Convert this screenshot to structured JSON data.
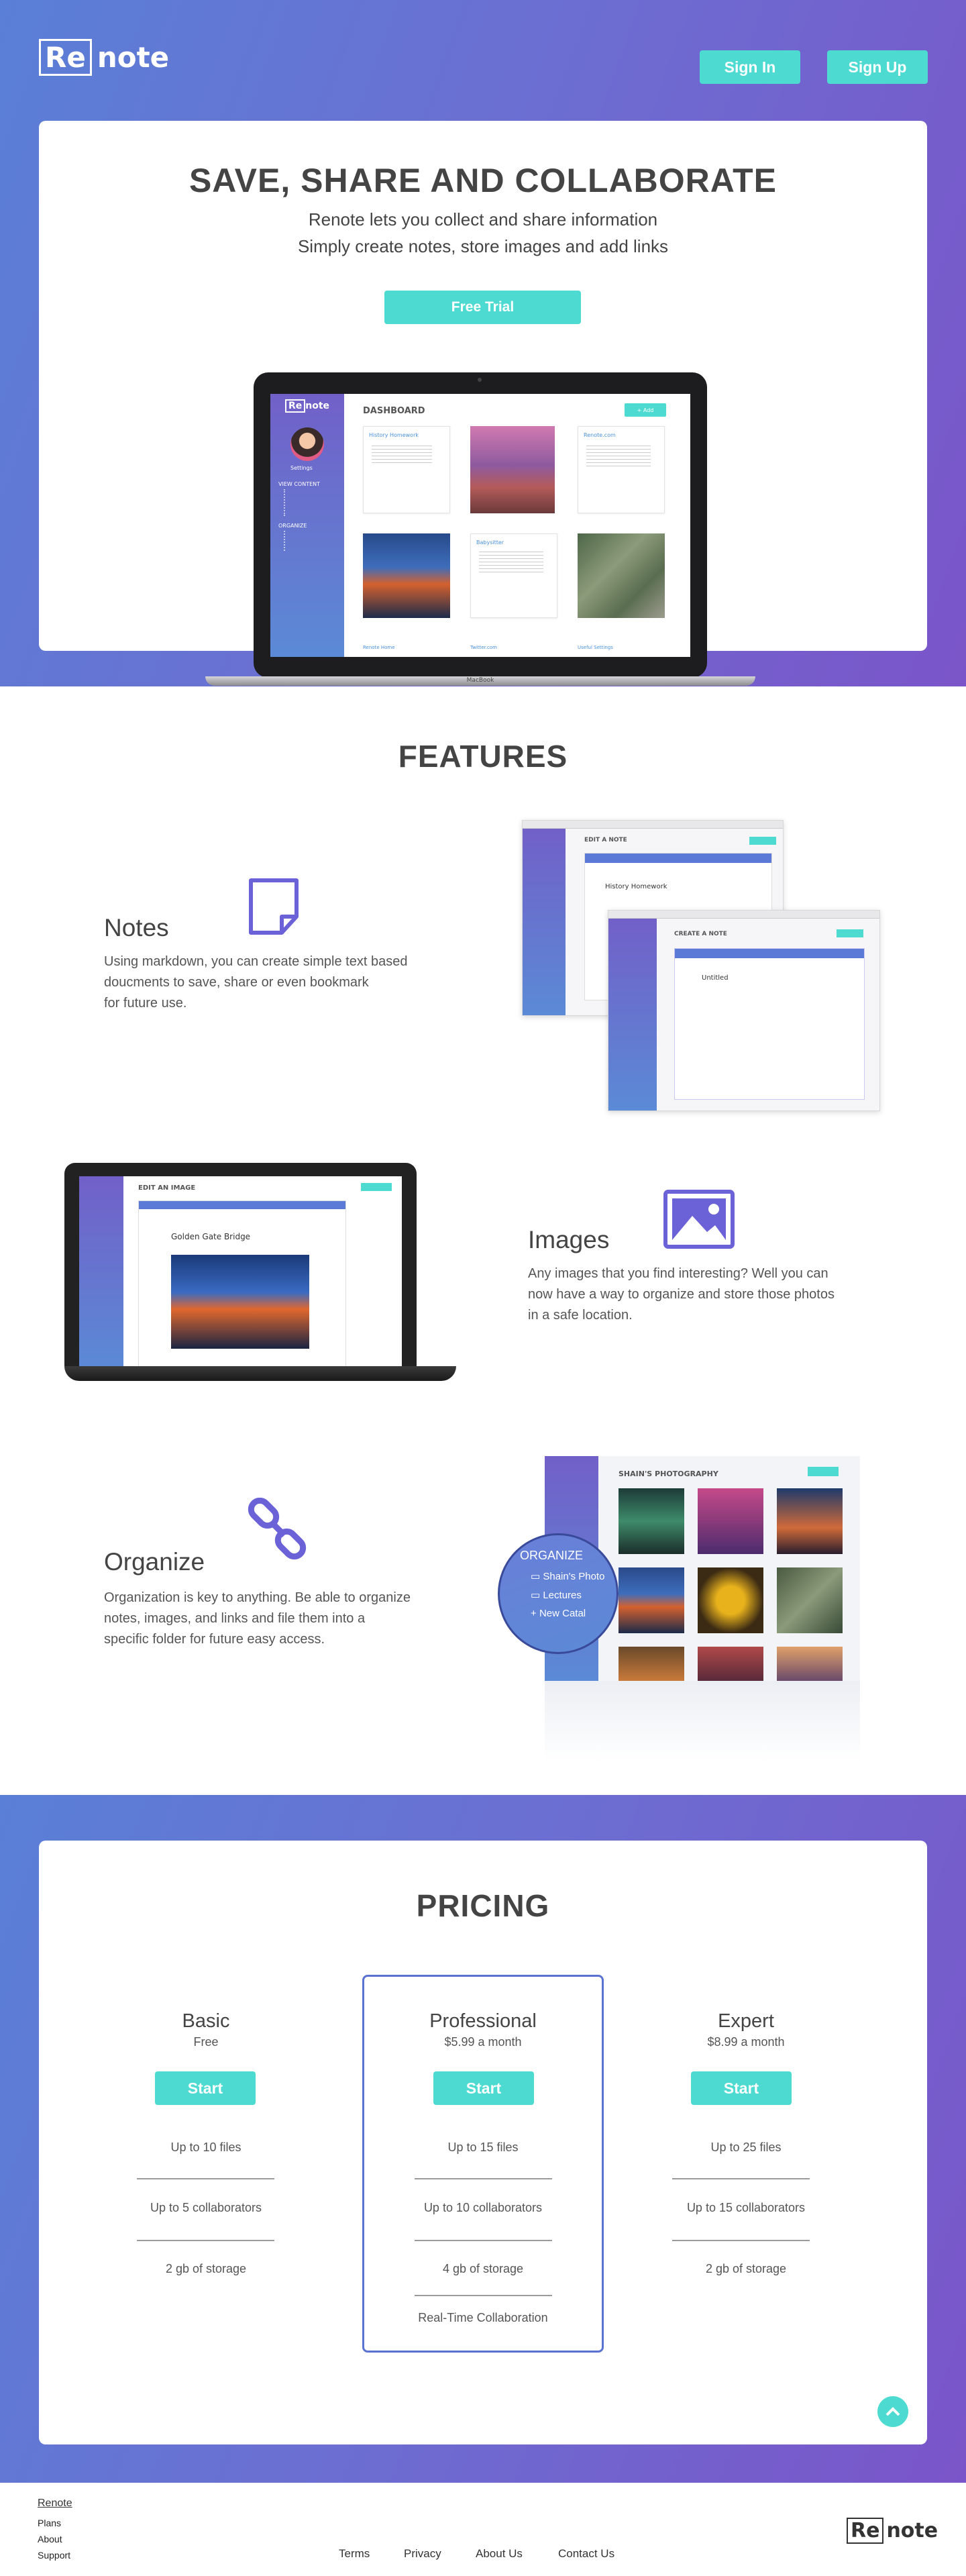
{
  "header": {
    "logo_re": "Re",
    "logo_note": "note",
    "sign_in": "Sign In",
    "sign_up": "Sign Up"
  },
  "hero": {
    "title": "SAVE, SHARE AND COLLABORATE",
    "line1": "Renote lets you collect and share information",
    "line2": "Simply create notes, store images and add links",
    "cta": "Free Trial",
    "laptop_label": "MacBook"
  },
  "dashboard": {
    "title": "DASHBOARD",
    "new_button": "+ Add",
    "user": "Settings",
    "view_content": "VIEW CONTENT",
    "organize": "ORGANIZE",
    "note1_title": "History Homework",
    "note2_title": "Renote.com",
    "note3_title": "Babysitter",
    "links": [
      "Renote Home",
      "Twitter.com",
      "Useful Settings"
    ]
  },
  "features": {
    "title": "FEATURES",
    "notes": {
      "title": "Notes",
      "text1": "Using markdown, you can create simple text based",
      "text2": "doucments to save, share or even bookmark",
      "text3": "for future use.",
      "shot1_title": "EDIT A NOTE",
      "shot1_field": "History Homework",
      "shot2_title": "CREATE A NOTE",
      "shot2_field": "Untitled"
    },
    "images": {
      "title": "Images",
      "text1": "Any images that you find interesting? Well you can",
      "text2": "now have a way to organize and store those photos",
      "text3": "in a safe location.",
      "shot_title": "EDIT AN IMAGE",
      "shot_field": "Golden Gate Bridge"
    },
    "organize": {
      "title": "Organize",
      "text1": "Organization is key to anything. Be able to organize",
      "text2": "notes, images, and links and file them into a",
      "text3": "specific folder for future easy access.",
      "shot_title": "SHAIN'S PHOTOGRAPHY",
      "zoom_title": "ORGANIZE",
      "zoom_items": [
        "Shain's Photo",
        "Lectures",
        "New Catal"
      ]
    }
  },
  "pricing": {
    "title": "PRICING",
    "plans": [
      {
        "name": "Basic",
        "price": "Free",
        "button": "Start",
        "features": [
          "Up to 10 files",
          "Up to 5 collaborators",
          "2 gb of storage"
        ]
      },
      {
        "name": "Professional",
        "price": "$5.99 a month",
        "button": "Start",
        "features": [
          "Up to 15 files",
          "Up to 10 collaborators",
          "4 gb of storage",
          "Real-Time Collaboration"
        ]
      },
      {
        "name": "Expert",
        "price": "$8.99 a month",
        "button": "Start",
        "features": [
          "Up to 25 files",
          "Up to 15 collaborators",
          "2 gb of storage"
        ]
      }
    ]
  },
  "footer": {
    "brand": "Renote",
    "col": [
      "Plans",
      "About",
      "Support"
    ],
    "links": [
      "Terms",
      "Privacy",
      "About Us",
      "Contact Us"
    ],
    "logo_re": "Re",
    "logo_note": "note"
  },
  "colors": {
    "teal": "#4ddad0",
    "purple": "#7a55c9",
    "blue": "#5a7fd6"
  }
}
